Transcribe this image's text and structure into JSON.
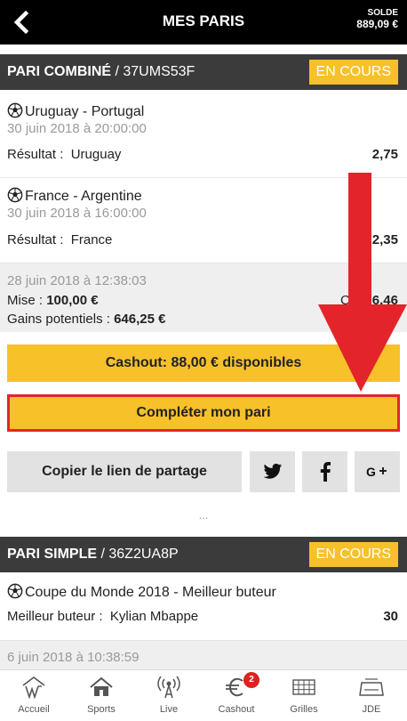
{
  "header": {
    "title": "MES PARIS",
    "solde_label": "SOLDE",
    "solde_value": "889,09 €"
  },
  "bet1": {
    "type_label": "PARI COMBINÉ",
    "code": " / 37UMS53F",
    "status": "EN COURS",
    "matches": [
      {
        "teams": "Uruguay - Portugal",
        "date": "30 juin 2018 à 20:00:00",
        "result_label": "Résultat :",
        "result_value": "Uruguay",
        "odds": "2,75"
      },
      {
        "teams": "France - Argentine",
        "date": "30 juin 2018 à 16:00:00",
        "result_label": "Résultat :",
        "result_value": "France",
        "odds": "2,35"
      }
    ],
    "summary": {
      "date": "28 juin 2018 à 12:38:03",
      "mise_label": "Mise",
      "mise_sep": " : ",
      "mise_value": "100,00 €",
      "cote_label": "Co",
      "cote_value": "6,46",
      "gains_label": "Gains potentiels",
      "gains_sep": " : ",
      "gains_value": "646,25 €"
    },
    "cashout_label": "Cashout: 88,00 € disponibles",
    "complete_label": "Compléter mon pari",
    "share_label": "Copier le lien de partage"
  },
  "dots": "...",
  "bet2": {
    "type_label": "PARI SIMPLE",
    "code": " / 36Z2UA8P",
    "status": "EN COURS",
    "match": {
      "competition": "Coupe du Monde 2018 - Meilleur buteur",
      "result_label": "Meilleur buteur :",
      "result_value": "Kylian Mbappe",
      "odds": "30"
    },
    "date": "6 juin 2018 à 10:38:59"
  },
  "nav": {
    "items": [
      {
        "label": "Accueil",
        "icon": "home-w-icon"
      },
      {
        "label": "Sports",
        "icon": "house-icon"
      },
      {
        "label": "Live",
        "icon": "live-icon"
      },
      {
        "label": "Cashout",
        "icon": "euro-icon",
        "badge": "2"
      },
      {
        "label": "Grilles",
        "icon": "grid-icon"
      },
      {
        "label": "JDE",
        "icon": "stadium-icon"
      }
    ]
  },
  "colors": {
    "accent_yellow": "#f7c12a",
    "header_dark": "#3b3b3b",
    "topbar": "#000000",
    "highlight_red": "#e3252b"
  }
}
